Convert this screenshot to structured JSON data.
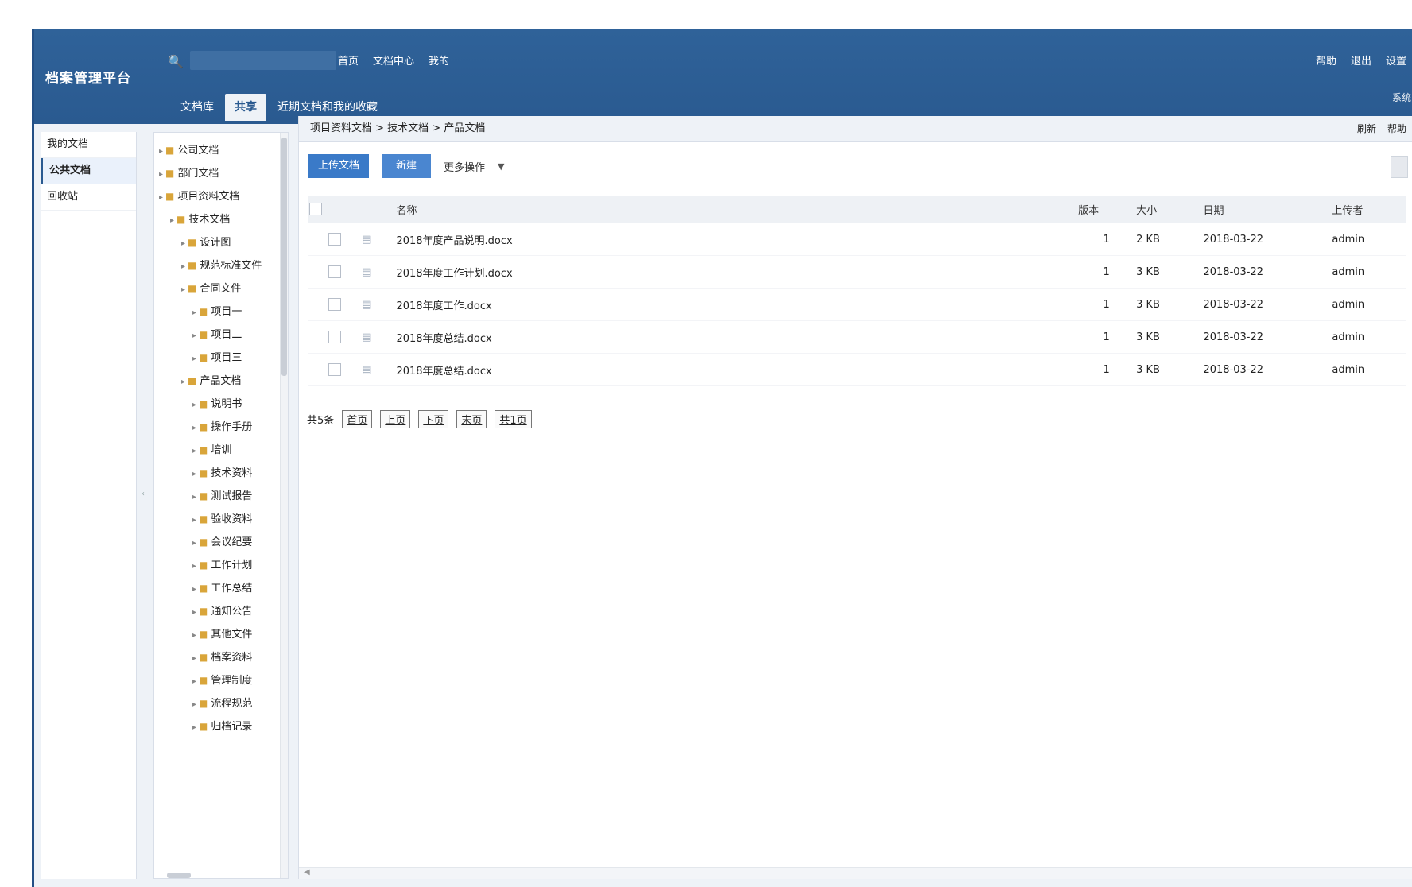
{
  "header": {
    "app_title": "档案管理平台",
    "search_placeholder": "",
    "links": [
      "首页",
      "文档中心",
      "我的"
    ],
    "right_links": [
      "帮助",
      "退出",
      "设置"
    ],
    "extra": "系统"
  },
  "main_tabs": [
    "文档库",
    "共享",
    "近期文档和我的收藏"
  ],
  "left_menu": [
    "我的文档",
    "公共文档",
    "回收站"
  ],
  "tree": [
    {
      "label": "公司文档",
      "level": 0
    },
    {
      "label": "部门文档",
      "level": 0
    },
    {
      "label": "项目资料文档",
      "level": 0
    },
    {
      "label": "技术文档",
      "level": 1
    },
    {
      "label": "设计图",
      "level": 2
    },
    {
      "label": "规范标准文件",
      "level": 2
    },
    {
      "label": "合同文件",
      "level": 2
    },
    {
      "label": "项目一",
      "level": 3
    },
    {
      "label": "项目二",
      "level": 3
    },
    {
      "label": "项目三",
      "level": 3
    },
    {
      "label": "产品文档",
      "level": 2
    },
    {
      "label": "说明书",
      "level": 3
    },
    {
      "label": "操作手册",
      "level": 3
    },
    {
      "label": "培训",
      "level": 3
    },
    {
      "label": "技术资料",
      "level": 3
    },
    {
      "label": "测试报告",
      "level": 3
    },
    {
      "label": "验收资料",
      "level": 3
    },
    {
      "label": "会议纪要",
      "level": 3
    },
    {
      "label": "工作计划",
      "level": 3
    },
    {
      "label": "工作总结",
      "level": 3
    },
    {
      "label": "通知公告",
      "level": 3
    },
    {
      "label": "其他文件",
      "level": 3
    },
    {
      "label": "档案资料",
      "level": 3
    },
    {
      "label": "管理制度",
      "level": 3
    },
    {
      "label": "流程规范",
      "level": 3
    },
    {
      "label": "归档记录",
      "level": 3
    }
  ],
  "content": {
    "breadcrumb": "项目资料文档 > 技术文档 > 产品文档",
    "breadcrumb_right": [
      "刷新",
      "帮助"
    ],
    "toolbar": {
      "upload": "上传文档",
      "new_folder": "新建",
      "more": "更多操作"
    },
    "columns": [
      "",
      "",
      "名称",
      "版本",
      "大小",
      "日期",
      "上传者"
    ],
    "rows": [
      {
        "name": "2018年度产品说明.docx",
        "version": "1",
        "size": "2 KB",
        "date": "2018-03-22",
        "user": "admin"
      },
      {
        "name": "2018年度工作计划.docx",
        "version": "1",
        "size": "3 KB",
        "date": "2018-03-22",
        "user": "admin"
      },
      {
        "name": "2018年度工作.docx",
        "version": "1",
        "size": "3 KB",
        "date": "2018-03-22",
        "user": "admin"
      },
      {
        "name": "2018年度总结.docx",
        "version": "1",
        "size": "3 KB",
        "date": "2018-03-22",
        "user": "admin"
      },
      {
        "name": "2018年度总结.docx",
        "version": "1",
        "size": "3 KB",
        "date": "2018-03-22",
        "user": "admin"
      }
    ],
    "pager": {
      "label": "共5条",
      "first": "首页",
      "prev": "上页",
      "next": "下页",
      "last": "末页",
      "total": "共1页"
    }
  }
}
